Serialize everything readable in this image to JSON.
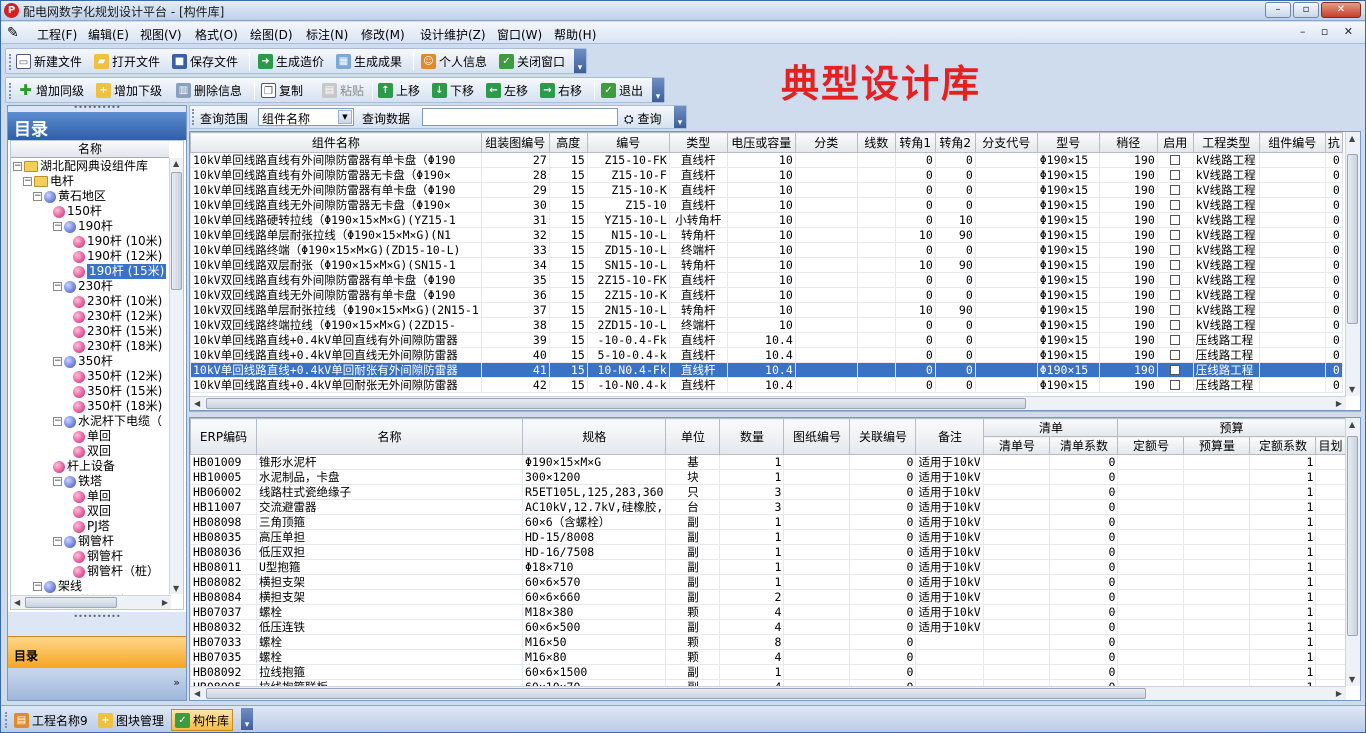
{
  "window": {
    "app_icon": "P",
    "title": "配电网数字化规划设计平台 - [构件库]",
    "btn_min": "–",
    "btn_max": "▫",
    "btn_close": "✕"
  },
  "menu": {
    "items": [
      "工程(F)",
      "编辑(E)",
      "视图(V)",
      "格式(O)",
      "绘图(D)",
      "标注(N)",
      "修改(M)",
      "设计维护(Z)",
      "窗口(W)",
      "帮助(H)"
    ],
    "mdi": "– ▫ ✕"
  },
  "toolbar1": {
    "new": "新建文件",
    "open": "打开文件",
    "save": "保存文件",
    "gen_cost": "生成造价",
    "gen_result": "生成成果",
    "personal": "个人信息",
    "close_win": "关闭窗口"
  },
  "toolbar2": {
    "add_same": "增加同级",
    "add_child": "增加下级",
    "delete": "删除信息",
    "copy": "复制",
    "paste": "粘贴",
    "up": "上移",
    "down": "下移",
    "left": "左移",
    "right": "右移",
    "exit": "退出"
  },
  "banner": "典型设计库",
  "left": {
    "header": "目录",
    "tree_header": "名称",
    "nav1": "目录",
    "nav2": "»",
    "tree": [
      {
        "label": "湖北配网典设组件库",
        "icon": "folder",
        "box": "−"
      },
      {
        "label": "电杆",
        "icon": "folder",
        "box": "−"
      },
      {
        "label": "黄石地区",
        "icon": "blue",
        "box": "−"
      },
      {
        "label": "150杆",
        "icon": "pink",
        "box": ""
      },
      {
        "label": "190杆",
        "icon": "blue",
        "box": "−"
      },
      {
        "label": "190杆 (10米)",
        "icon": "pink",
        "box": ""
      },
      {
        "label": "190杆 (12米)",
        "icon": "pink",
        "box": ""
      },
      {
        "label": "190杆 (15米)",
        "icon": "pink",
        "box": "",
        "selected": true
      },
      {
        "label": "230杆",
        "icon": "blue",
        "box": "−"
      },
      {
        "label": "230杆 (10米)",
        "icon": "pink",
        "box": ""
      },
      {
        "label": "230杆 (12米)",
        "icon": "pink",
        "box": ""
      },
      {
        "label": "230杆 (15米)",
        "icon": "pink",
        "box": ""
      },
      {
        "label": "230杆 (18米)",
        "icon": "pink",
        "box": ""
      },
      {
        "label": "350杆",
        "icon": "blue",
        "box": "−"
      },
      {
        "label": "350杆 (12米)",
        "icon": "pink",
        "box": ""
      },
      {
        "label": "350杆 (15米)",
        "icon": "pink",
        "box": ""
      },
      {
        "label": "350杆 (18米)",
        "icon": "pink",
        "box": ""
      },
      {
        "label": "水泥杆下电缆（",
        "icon": "blue",
        "box": "−"
      },
      {
        "label": "单回",
        "icon": "pink",
        "box": ""
      },
      {
        "label": "双回",
        "icon": "pink",
        "box": ""
      },
      {
        "label": "杆上设备",
        "icon": "pink",
        "box": ""
      },
      {
        "label": "铁塔",
        "icon": "blue",
        "box": "−"
      },
      {
        "label": "单回",
        "icon": "pink",
        "box": ""
      },
      {
        "label": "双回",
        "icon": "pink",
        "box": ""
      },
      {
        "label": "PJ塔",
        "icon": "pink",
        "box": ""
      },
      {
        "label": "钢管杆",
        "icon": "blue",
        "box": "−"
      },
      {
        "label": "钢管杆",
        "icon": "pink",
        "box": ""
      },
      {
        "label": "钢管杆（桩）",
        "icon": "pink",
        "box": ""
      },
      {
        "label": "架线",
        "icon": "blue",
        "box": "−"
      },
      {
        "label": "钢芯铝绞线",
        "icon": "pink",
        "box": ""
      }
    ]
  },
  "query": {
    "range_label": "查询范围",
    "range_value": "组件名称",
    "data_label": "查询数据",
    "search_btn": "查询"
  },
  "upper_table": {
    "columns": [
      "组件名称",
      "组装图编号",
      "高度",
      "编号",
      "类型",
      "电压或容量",
      "分类",
      "线数",
      "转角1",
      "转角2",
      "分支代号",
      "型号",
      "稍径",
      "启用",
      "工程类型",
      "组件编号",
      "抗"
    ],
    "rows": [
      [
        "10kV单回线路直线有外间隙防雷器有单卡盘（Φ190",
        "27",
        "15",
        "Z15-10-FK",
        "直线杆",
        "10",
        "",
        "",
        "0",
        "0",
        "",
        "Φ190×15",
        "190",
        "",
        "kV线路工程",
        "",
        "0"
      ],
      [
        "10kV单回线路直线有外间隙防雷器无卡盘（Φ190×",
        "28",
        "15",
        "Z15-10-F",
        "直线杆",
        "10",
        "",
        "",
        "0",
        "0",
        "",
        "Φ190×15",
        "190",
        "",
        "kV线路工程",
        "",
        "0"
      ],
      [
        "10kV单回线路直线无外间隙防雷器有单卡盘（Φ190",
        "29",
        "15",
        "Z15-10-K",
        "直线杆",
        "10",
        "",
        "",
        "0",
        "0",
        "",
        "Φ190×15",
        "190",
        "",
        "kV线路工程",
        "",
        "0"
      ],
      [
        "10kV单回线路直线无外间隙防雷器无卡盘（Φ190×",
        "30",
        "15",
        "Z15-10",
        "直线杆",
        "10",
        "",
        "",
        "0",
        "0",
        "",
        "Φ190×15",
        "190",
        "",
        "kV线路工程",
        "",
        "0"
      ],
      [
        "10kV单回线路硬转拉线（Φ190×15×M×G)(YZ15-1",
        "31",
        "15",
        "YZ15-10-L",
        "小转角杆",
        "10",
        "",
        "",
        "0",
        "10",
        "",
        "Φ190×15",
        "190",
        "",
        "kV线路工程",
        "",
        "0"
      ],
      [
        "10kV单回线路单层耐张拉线（Φ190×15×M×G)(N1",
        "32",
        "15",
        "N15-10-L",
        "转角杆",
        "10",
        "",
        "",
        "10",
        "90",
        "",
        "Φ190×15",
        "190",
        "",
        "kV线路工程",
        "",
        "0"
      ],
      [
        "10kV单回线路终端（Φ190×15×M×G)(ZD15-10-L)",
        "33",
        "15",
        "ZD15-10-L",
        "终端杆",
        "10",
        "",
        "",
        "0",
        "0",
        "",
        "Φ190×15",
        "190",
        "",
        "kV线路工程",
        "",
        "0"
      ],
      [
        "10kV单回线路双层耐张（Φ190×15×M×G)(SN15-1",
        "34",
        "15",
        "SN15-10-L",
        "转角杆",
        "10",
        "",
        "",
        "10",
        "90",
        "",
        "Φ190×15",
        "190",
        "",
        "kV线路工程",
        "",
        "0"
      ],
      [
        "10kV双回线路直线有外间隙防雷器有单卡盘（Φ190",
        "35",
        "15",
        "2Z15-10-FK",
        "直线杆",
        "10",
        "",
        "",
        "0",
        "0",
        "",
        "Φ190×15",
        "190",
        "",
        "kV线路工程",
        "",
        "0"
      ],
      [
        "10kV双回线路直线无外间隙防雷器有单卡盘（Φ190",
        "36",
        "15",
        "2Z15-10-K",
        "直线杆",
        "10",
        "",
        "",
        "0",
        "0",
        "",
        "Φ190×15",
        "190",
        "",
        "kV线路工程",
        "",
        "0"
      ],
      [
        "10kV双回线路单层耐张拉线（Φ190×15×M×G)(2N15-1",
        "37",
        "15",
        "2N15-10-L",
        "转角杆",
        "10",
        "",
        "",
        "10",
        "90",
        "",
        "Φ190×15",
        "190",
        "",
        "kV线路工程",
        "",
        "0"
      ],
      [
        "10kV双回线路终端拉线（Φ190×15×M×G)(2ZD15-",
        "38",
        "15",
        "2ZD15-10-L",
        "终端杆",
        "10",
        "",
        "",
        "0",
        "0",
        "",
        "Φ190×15",
        "190",
        "",
        "kV线路工程",
        "",
        "0"
      ],
      [
        "10kV单回线路直线+0.4kV单回直线有外间隙防雷器",
        "39",
        "15",
        "-10-0.4-Fk",
        "直线杆",
        "10.4",
        "",
        "",
        "0",
        "0",
        "",
        "Φ190×15",
        "190",
        "",
        "压线路工程",
        "",
        "0"
      ],
      [
        "10kV单回线路直线+0.4kV单回直线无外间隙防雷器",
        "40",
        "15",
        "5-10-0.4-k",
        "直线杆",
        "10.4",
        "",
        "",
        "0",
        "0",
        "",
        "Φ190×15",
        "190",
        "",
        "压线路工程",
        "",
        "0"
      ],
      [
        "10kV单回线路直线+0.4kV单回耐张有外间隙防雷器",
        "41",
        "15",
        "10-N0.4-Fk",
        "直线杆",
        "10.4",
        "",
        "",
        "0",
        "0",
        "",
        "Φ190×15",
        "190",
        "",
        "压线路工程",
        "",
        "0"
      ],
      [
        "10kV单回线路直线+0.4kV单回耐张无外间隙防雷器",
        "42",
        "15",
        "-10-N0.4-k",
        "直线杆",
        "10.4",
        "",
        "",
        "0",
        "0",
        "",
        "Φ190×15",
        "190",
        "",
        "压线路工程",
        "",
        "0"
      ]
    ],
    "selected_row": 14
  },
  "lower_table": {
    "group_qingdan": "清单",
    "group_yusuan": "预算",
    "columns": [
      "ERP编码",
      "名称",
      "规格",
      "单位",
      "数量",
      "图纸编号",
      "关联编号",
      "备注",
      "清单号",
      "清单系数",
      "定额号",
      "预算量",
      "定额系数",
      "目划"
    ],
    "rows": [
      [
        "HB01009",
        "锥形水泥杆",
        "Φ190×15×M×G",
        "基",
        "1",
        "0",
        "适用于10kV",
        "",
        "0",
        "",
        "",
        "1",
        ""
      ],
      [
        "HB10005",
        "水泥制品，卡盘",
        "300×1200",
        "块",
        "1",
        "0",
        "适用于10kV",
        "",
        "0",
        "",
        "",
        "1",
        ""
      ],
      [
        "HB06002",
        "线路柱式瓷绝缘子",
        "R5ET105L,125,283,360",
        "只",
        "3",
        "0",
        "适用于10kV",
        "",
        "0",
        "",
        "",
        "1",
        ""
      ],
      [
        "HB11007",
        "交流避雷器",
        "AC10kV,12.7kV,硅橡胶,",
        "台",
        "3",
        "0",
        "适用于10kV",
        "",
        "0",
        "",
        "",
        "1",
        ""
      ],
      [
        "HB08098",
        "三角顶箍",
        "60×6（含螺栓）",
        "副",
        "1",
        "0",
        "适用于10kV",
        "",
        "0",
        "",
        "",
        "1",
        ""
      ],
      [
        "HB08035",
        "高压单担",
        "HD-15/8008",
        "副",
        "1",
        "0",
        "适用于10kV",
        "",
        "0",
        "",
        "",
        "1",
        ""
      ],
      [
        "HB08036",
        "低压双担",
        "HD-16/7508",
        "副",
        "1",
        "0",
        "适用于10kV",
        "",
        "0",
        "",
        "",
        "1",
        ""
      ],
      [
        "HB08011",
        "U型抱箍",
        "Φ18×710",
        "副",
        "1",
        "0",
        "适用于10kV",
        "",
        "0",
        "",
        "",
        "1",
        ""
      ],
      [
        "HB08082",
        "横担支架",
        "60×6×570",
        "副",
        "1",
        "0",
        "适用于10kV",
        "",
        "0",
        "",
        "",
        "1",
        ""
      ],
      [
        "HB08084",
        "横担支架",
        "60×6×660",
        "副",
        "2",
        "0",
        "适用于10kV",
        "",
        "0",
        "",
        "",
        "1",
        ""
      ],
      [
        "HB07037",
        "螺栓",
        "M18×380",
        "颗",
        "4",
        "0",
        "适用于10kV",
        "",
        "0",
        "",
        "",
        "1",
        ""
      ],
      [
        "HB08032",
        "低压连铁",
        "60×6×500",
        "副",
        "4",
        "0",
        "适用于10kV",
        "",
        "0",
        "",
        "",
        "1",
        ""
      ],
      [
        "HB07033",
        "螺栓",
        "M16×50",
        "颗",
        "8",
        "0",
        "",
        "",
        "0",
        "",
        "",
        "1",
        ""
      ],
      [
        "HB07035",
        "螺栓",
        "M16×80",
        "颗",
        "4",
        "0",
        "",
        "",
        "0",
        "",
        "",
        "1",
        ""
      ],
      [
        "HB08092",
        "拉线抱箍",
        "60×6×1500",
        "副",
        "1",
        "0",
        "",
        "",
        "0",
        "",
        "",
        "1",
        ""
      ],
      [
        "HB08095",
        "拉线抱箍联板",
        "60×10×70",
        "副",
        "4",
        "0",
        "",
        "",
        "0",
        "",
        "",
        "1",
        ""
      ]
    ]
  },
  "status": {
    "tab1": "工程名称9",
    "tab2": "图块管理",
    "tab3": "构件库"
  },
  "colors": {
    "accent": "#3a73c6",
    "banner": "#e52020",
    "nav_active": "#f5a623"
  }
}
